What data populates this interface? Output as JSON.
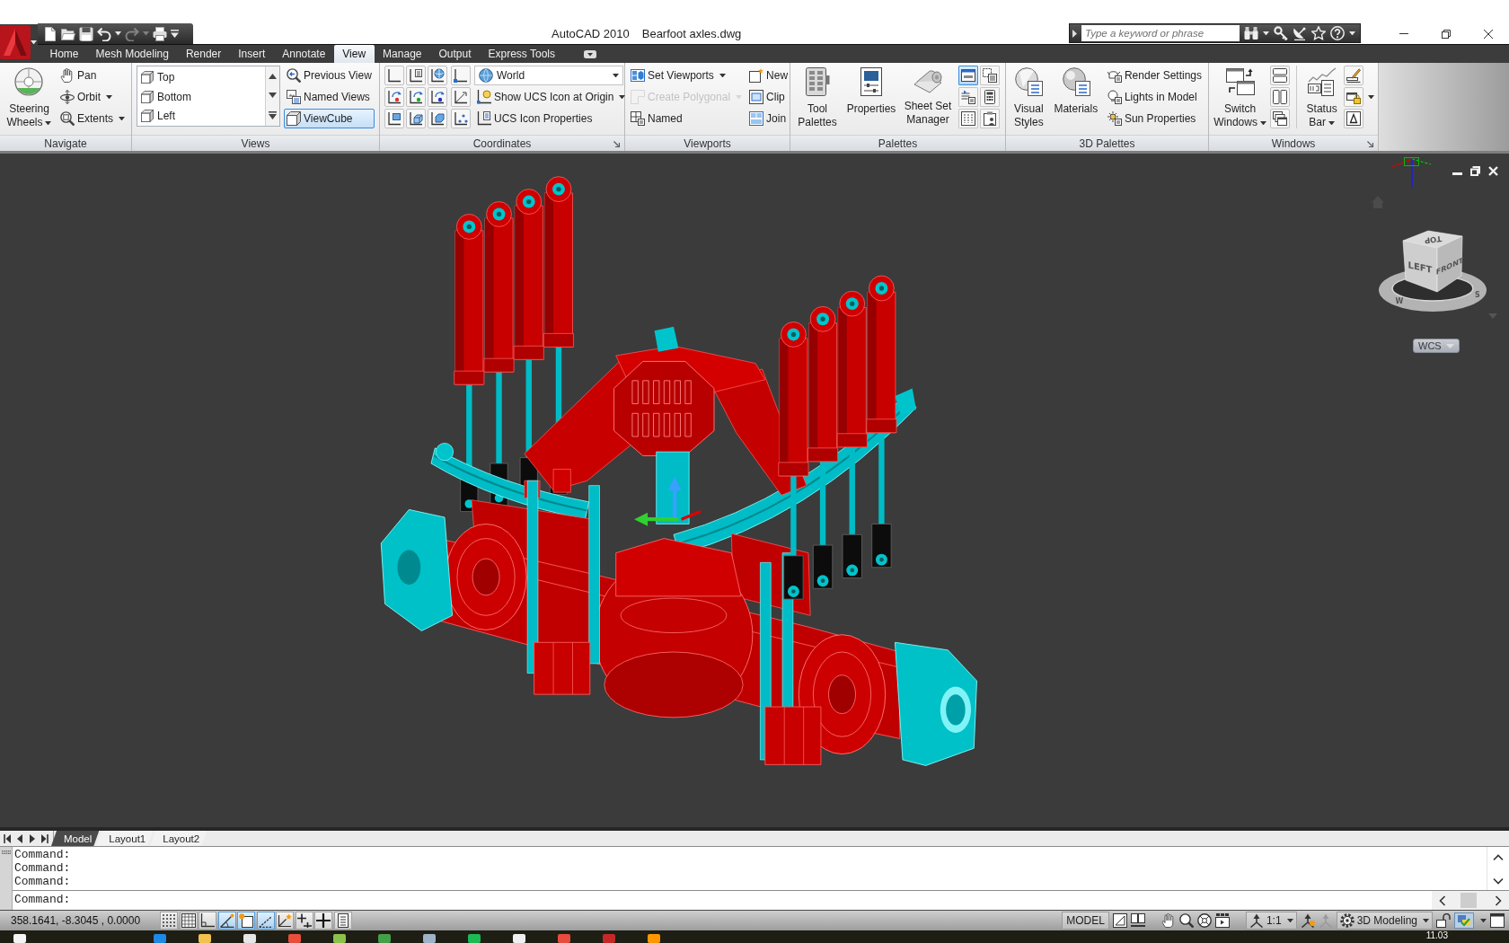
{
  "title_bar": {
    "quick_access": [
      {
        "disabled": false
      },
      {
        "disabled": false
      },
      {
        "disabled": false
      },
      {
        "disabled": false
      },
      {
        "disabled": true
      },
      {
        "disabled": false
      }
    ],
    "app_name": "AutoCAD 2010",
    "document": "Bearfoot axles.dwg",
    "search": {
      "placeholder": "Type a keyword or phrase"
    }
  },
  "ribbon_tabs": [
    {
      "label": "Home",
      "selected": false
    },
    {
      "label": "Mesh Modeling",
      "selected": false
    },
    {
      "label": "Render",
      "selected": false
    },
    {
      "label": "Insert",
      "selected": false
    },
    {
      "label": "Annotate",
      "selected": false
    },
    {
      "label": "View",
      "selected": true
    },
    {
      "label": "Manage",
      "selected": false
    },
    {
      "label": "Output",
      "selected": false
    },
    {
      "label": "Express Tools",
      "selected": false
    }
  ],
  "ribbon_panels": [
    {
      "title": "Navigate",
      "large_button": {
        "label": "Steering Wheels",
        "dropdown": true
      },
      "buttons": [
        {
          "label": "Pan",
          "dropdown": false
        },
        {
          "label": "Orbit",
          "dropdown": true
        },
        {
          "label": "Extents",
          "dropdown": true
        }
      ]
    },
    {
      "title": "Views",
      "view_list": [
        {
          "label": "Top"
        },
        {
          "label": "Bottom"
        },
        {
          "label": "Left"
        }
      ],
      "buttons": [
        {
          "label": "Previous View",
          "on": false
        },
        {
          "label": "Named Views",
          "on": false
        },
        {
          "label": "ViewCube",
          "on": true
        }
      ]
    },
    {
      "title": "Coordinates",
      "ucs_dropdown": {
        "value": "World"
      },
      "buttons": [
        {
          "label": "Show UCS Icon at Origin",
          "dropdown": true
        },
        {
          "label": "UCS Icon Properties",
          "dropdown": false
        }
      ]
    },
    {
      "title": "Viewports",
      "buttons": [
        {
          "label": "Set Viewports",
          "dropdown": true,
          "disabled": false
        },
        {
          "label": "Create Polygonal",
          "dropdown": true,
          "disabled": true
        },
        {
          "label": "Named",
          "dropdown": false,
          "disabled": false
        }
      ],
      "buttons_right": [
        {
          "label": "New"
        },
        {
          "label": "Clip"
        },
        {
          "label": "Join"
        }
      ]
    },
    {
      "title": "Palettes",
      "large_buttons": [
        {
          "label": "Tool Palettes"
        },
        {
          "label": "Properties"
        },
        {
          "label": "Sheet Set Manager"
        }
      ],
      "toggles": [
        {
          "on": true
        },
        {
          "on": false
        },
        {
          "on": false
        },
        {
          "on": false
        },
        {
          "on": false
        },
        {
          "on": false
        }
      ]
    },
    {
      "title": "3D Palettes",
      "large_buttons": [
        {
          "label": "Visual Styles"
        },
        {
          "label": "Materials"
        }
      ],
      "buttons": [
        {
          "label": "Render Settings"
        },
        {
          "label": "Lights in Model"
        },
        {
          "label": "Sun Properties"
        }
      ]
    },
    {
      "title": "Windows",
      "large_buttons": [
        {
          "label": "Switch Windows",
          "dropdown": true
        },
        {
          "label": "Status Bar",
          "dropdown": true
        }
      ]
    }
  ],
  "viewport": {
    "viewcube": {
      "top": "TOP",
      "left": "LEFT",
      "front": "FRONT",
      "compass": [
        "W",
        "S"
      ]
    },
    "ucs_menu": "WCS"
  },
  "layout_tabs": [
    {
      "label": "Model",
      "selected": true
    },
    {
      "label": "Layout1",
      "selected": false
    },
    {
      "label": "Layout2",
      "selected": false
    }
  ],
  "command_line": {
    "history": [
      "Command:",
      "Command:",
      "Command:"
    ],
    "prompt": "Command:"
  },
  "status_bar": {
    "coordinates": "358.1641, -8.3045 , 0.0000",
    "toggles": [
      {
        "on": false
      },
      {
        "on": false
      },
      {
        "on": false
      },
      {
        "on": true
      },
      {
        "on": true
      },
      {
        "on": true
      },
      {
        "on": false
      },
      {
        "on": false
      },
      {
        "on": false
      },
      {
        "on": false
      }
    ],
    "space": "MODEL",
    "annotation_scale": "1:1",
    "workspace": "3D Modeling"
  },
  "taskbar": {
    "clock": "11.03"
  }
}
